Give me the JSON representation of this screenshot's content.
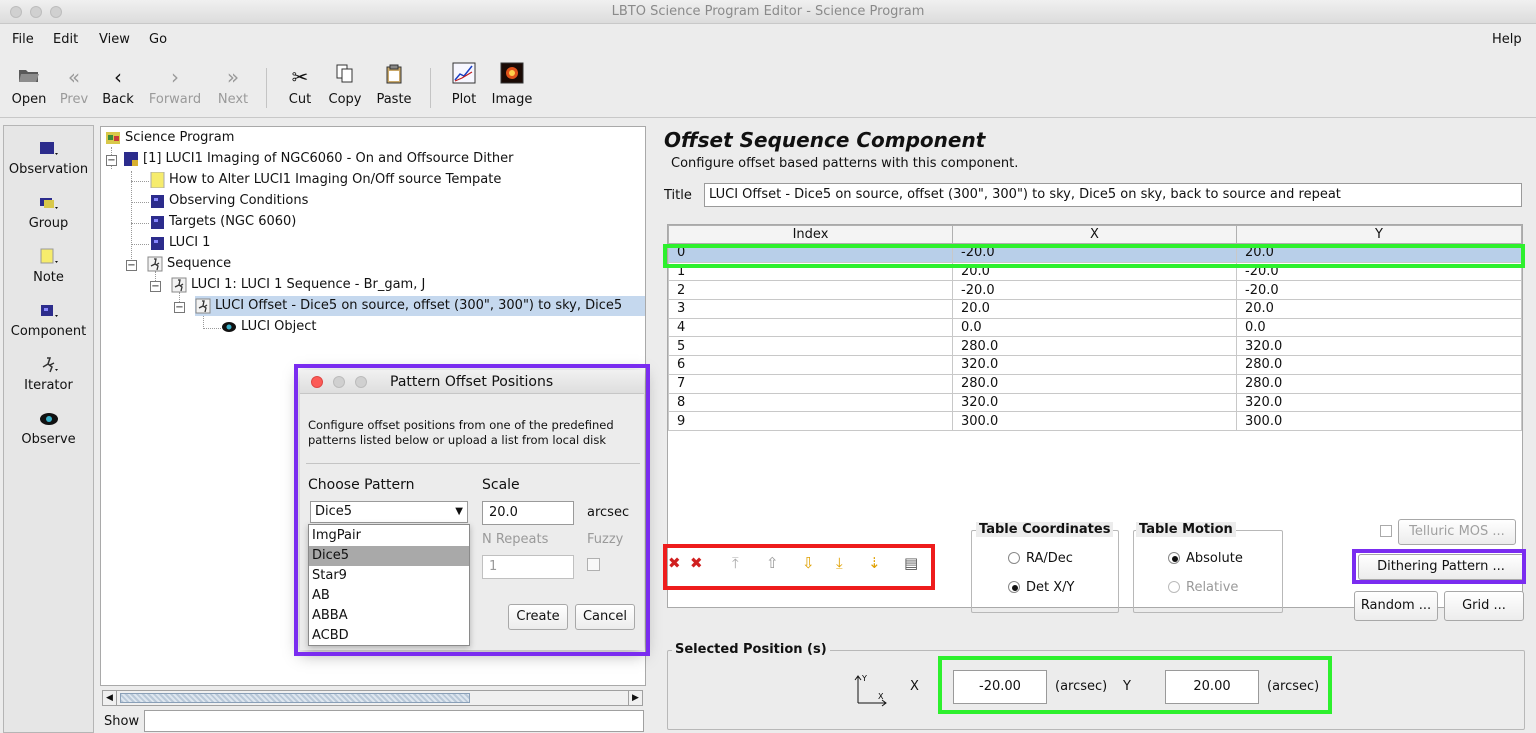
{
  "window": {
    "title": "LBTO Science Program Editor - Science Program"
  },
  "menubar": {
    "items": [
      "File",
      "Edit",
      "View",
      "Go"
    ],
    "help": "Help"
  },
  "toolbar": {
    "open": "Open",
    "prev": "Prev",
    "back": "Back",
    "forward": "Forward",
    "next": "Next",
    "cut": "Cut",
    "copy": "Copy",
    "paste": "Paste",
    "plot": "Plot",
    "image": "Image"
  },
  "palette": [
    "Observation",
    "Group",
    "Note",
    "Component",
    "Iterator",
    "Observe"
  ],
  "tree": {
    "root": "Science Program",
    "program": "[1] LUCI1 Imaging of NGC6060 - On and Offsource Dither",
    "note": "How to Alter LUCI1 Imaging On/Off source Tempate",
    "conditions": "Observing Conditions",
    "targets": "Targets (NGC 6060)",
    "instrument": "LUCI 1",
    "sequence": "Sequence",
    "luci_seq": "LUCI 1: LUCI 1 Sequence - Br_gam,  J",
    "offset": "LUCI Offset - Dice5 on source, offset (300\", 300\") to sky, Dice5",
    "object": "LUCI Object"
  },
  "show_label": "Show",
  "component": {
    "heading": "Offset Sequence Component",
    "description": "Configure offset based patterns with this component.",
    "title_label": "Title",
    "title_value": "LUCI Offset - Dice5 on source, offset (300\", 300\") to sky, Dice5 on sky, back to source and repeat",
    "columns": [
      "Index",
      "X",
      "Y"
    ],
    "rows": [
      [
        "0",
        "-20.0",
        "20.0"
      ],
      [
        "1",
        "20.0",
        "-20.0"
      ],
      [
        "2",
        "-20.0",
        "-20.0"
      ],
      [
        "3",
        "20.0",
        "20.0"
      ],
      [
        "4",
        "0.0",
        "0.0"
      ],
      [
        "5",
        "280.0",
        "320.0"
      ],
      [
        "6",
        "320.0",
        "280.0"
      ],
      [
        "7",
        "280.0",
        "280.0"
      ],
      [
        "8",
        "320.0",
        "320.0"
      ],
      [
        "9",
        "300.0",
        "300.0"
      ]
    ],
    "table_coordinates": {
      "legend": "Table Coordinates",
      "ra_dec": "RA/Dec",
      "det_xy": "Det X/Y",
      "selected": "Det X/Y"
    },
    "table_motion": {
      "legend": "Table Motion",
      "absolute": "Absolute",
      "relative": "Relative",
      "selected": "Absolute"
    },
    "telluric": "Telluric MOS ...",
    "dithering": "Dithering Pattern ...",
    "random": "Random ...",
    "grid": "Grid ...",
    "selected_position": {
      "legend": "Selected Position (s)",
      "x_label": "X",
      "x_value": "-20.00",
      "x_unit": "(arcsec)",
      "y_label": "Y",
      "y_value": "20.00",
      "y_unit": "(arcsec)"
    }
  },
  "dialog": {
    "title": "Pattern Offset Positions",
    "description": "Configure offset positions from one of the predefined patterns listed below or upload a list from local disk",
    "choose_label": "Choose Pattern",
    "scale_label": "Scale",
    "selected_pattern": "Dice5",
    "scale_value": "20.0",
    "scale_unit": "arcsec",
    "repeats_label": "N Repeats",
    "repeats_value": "1",
    "fuzzy_label": "Fuzzy",
    "options": [
      "ImgPair",
      "Dice5",
      "Star9",
      "AB",
      "ABBA",
      "ACBD"
    ],
    "create": "Create",
    "cancel": "Cancel"
  },
  "colors": {
    "highlight_green": "#2df02d",
    "highlight_purple": "#7a2cf0",
    "highlight_red": "#ee1c1c",
    "selection": "#b8cfe9"
  }
}
